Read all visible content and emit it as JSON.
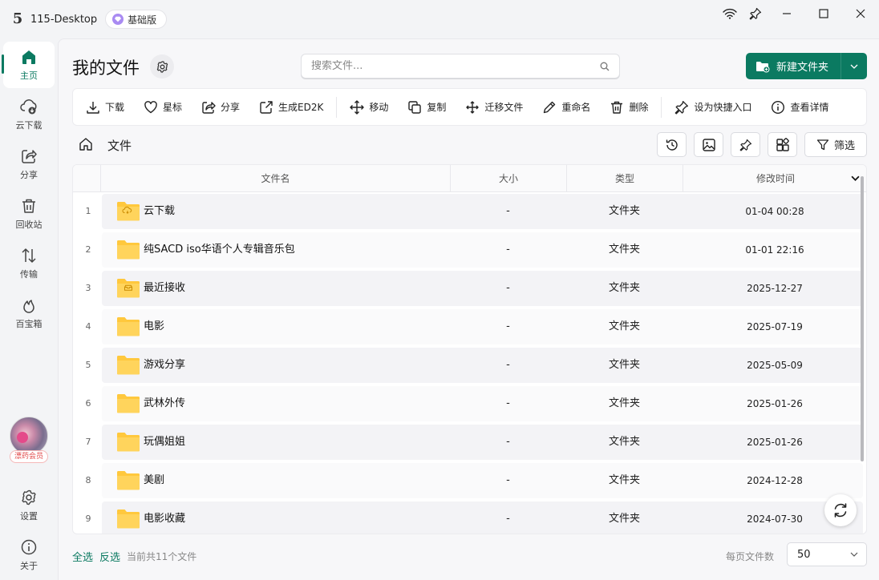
{
  "window": {
    "app_title": "115-Desktop",
    "plan_badge": "基础版",
    "logo_glyph": "5"
  },
  "sidebar": {
    "items": [
      {
        "label": "主页",
        "icon": "home-icon",
        "active": true
      },
      {
        "label": "云下载",
        "icon": "cloud-download-icon"
      },
      {
        "label": "分享",
        "icon": "share-icon"
      },
      {
        "label": "回收站",
        "icon": "trash-icon"
      },
      {
        "label": "传输",
        "icon": "transfer-icon"
      },
      {
        "label": "百宝箱",
        "icon": "flame-icon"
      }
    ],
    "member_tag": "漂药会员",
    "settings_label": "设置",
    "about_label": "关于"
  },
  "header": {
    "page_title": "我的文件",
    "search_placeholder": "搜索文件...",
    "new_folder_label": "新建文件夹"
  },
  "toolbar": {
    "items": [
      {
        "label": "下载",
        "icon": "download-icon"
      },
      {
        "label": "星标",
        "icon": "heart-icon"
      },
      {
        "label": "分享",
        "icon": "share-icon"
      },
      {
        "label": "生成ED2K",
        "icon": "external-link-icon"
      },
      {
        "label": "移动",
        "icon": "move-icon"
      },
      {
        "label": "复制",
        "icon": "copy-icon"
      },
      {
        "label": "迁移文件",
        "icon": "migrate-icon"
      },
      {
        "label": "重命名",
        "icon": "pencil-icon"
      },
      {
        "label": "删除",
        "icon": "trash-icon"
      },
      {
        "label": "设为快捷入口",
        "icon": "pin-icon"
      },
      {
        "label": "查看详情",
        "icon": "info-icon"
      }
    ]
  },
  "breadcrumb": {
    "current": "文件",
    "filter_label": "筛选"
  },
  "table": {
    "columns": [
      "文件名",
      "大小",
      "类型",
      "修改时间"
    ],
    "rows": [
      {
        "index": "1",
        "name": "云下载",
        "size": "-",
        "type": "文件夹",
        "modified": "01-04 00:28",
        "badge": "cloud"
      },
      {
        "index": "2",
        "name": "纯SACD iso华语个人专辑音乐包",
        "size": "-",
        "type": "文件夹",
        "modified": "01-01 22:16",
        "badge": ""
      },
      {
        "index": "3",
        "name": "最近接收",
        "size": "-",
        "type": "文件夹",
        "modified": "2025-12-27",
        "badge": "inbox"
      },
      {
        "index": "4",
        "name": "电影",
        "size": "-",
        "type": "文件夹",
        "modified": "2025-07-19",
        "badge": ""
      },
      {
        "index": "5",
        "name": "游戏分享",
        "size": "-",
        "type": "文件夹",
        "modified": "2025-05-09",
        "badge": ""
      },
      {
        "index": "6",
        "name": "武林外传",
        "size": "-",
        "type": "文件夹",
        "modified": "2025-01-26",
        "badge": ""
      },
      {
        "index": "7",
        "name": "玩偶姐姐",
        "size": "-",
        "type": "文件夹",
        "modified": "2025-01-26",
        "badge": ""
      },
      {
        "index": "8",
        "name": "美剧",
        "size": "-",
        "type": "文件夹",
        "modified": "2024-12-28",
        "badge": ""
      },
      {
        "index": "9",
        "name": "电影收藏",
        "size": "-",
        "type": "文件夹",
        "modified": "2024-07-30",
        "badge": ""
      }
    ]
  },
  "footer": {
    "select_all": "全选",
    "invert": "反选",
    "count_text": "当前共11个文件",
    "per_page_label": "每页文件数",
    "per_page_value": "50"
  },
  "colors": {
    "accent": "#0b7a61",
    "folder": "#ffc83d",
    "member_red": "#e24b4b"
  }
}
